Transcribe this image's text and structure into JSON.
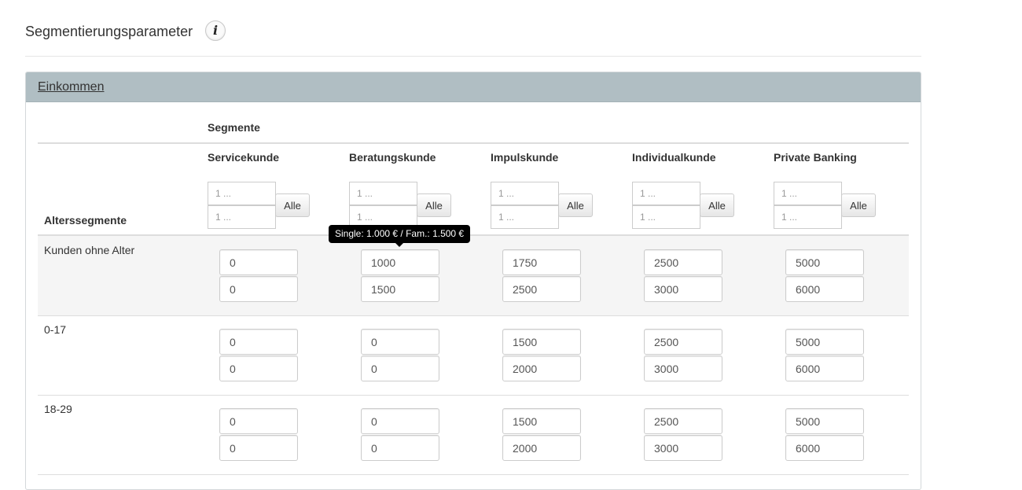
{
  "header": {
    "title": "Segmentierungsparameter",
    "info_icon": "info-icon"
  },
  "panel": {
    "title": "Einkommen"
  },
  "table": {
    "group_header": "Segmente",
    "row_header": "Alterssegmente",
    "columns": [
      "Servicekunde",
      "Beratungskunde",
      "Impulskunde",
      "Individualkunde",
      "Private Banking"
    ],
    "filter_placeholder": "1 ...",
    "all_button_label": "Alle",
    "rows": [
      {
        "label": "Kunden ohne Alter",
        "values": [
          [
            "0",
            "0"
          ],
          [
            "1000",
            "1500"
          ],
          [
            "1750",
            "2500"
          ],
          [
            "2500",
            "3000"
          ],
          [
            "5000",
            "6000"
          ]
        ]
      },
      {
        "label": "0-17",
        "values": [
          [
            "0",
            "0"
          ],
          [
            "0",
            "0"
          ],
          [
            "1500",
            "2000"
          ],
          [
            "2500",
            "3000"
          ],
          [
            "5000",
            "6000"
          ]
        ]
      },
      {
        "label": "18-29",
        "values": [
          [
            "0",
            "0"
          ],
          [
            "0",
            "0"
          ],
          [
            "1500",
            "2000"
          ],
          [
            "2500",
            "3000"
          ],
          [
            "5000",
            "6000"
          ]
        ]
      }
    ]
  },
  "tooltip": {
    "text": "Single: 1.000 € / Fam.: 1.500 €"
  },
  "colors": {
    "panel_heading": "#b0bec3",
    "row_highlight": "#f5f5f5",
    "tooltip_bg": "#000000"
  }
}
